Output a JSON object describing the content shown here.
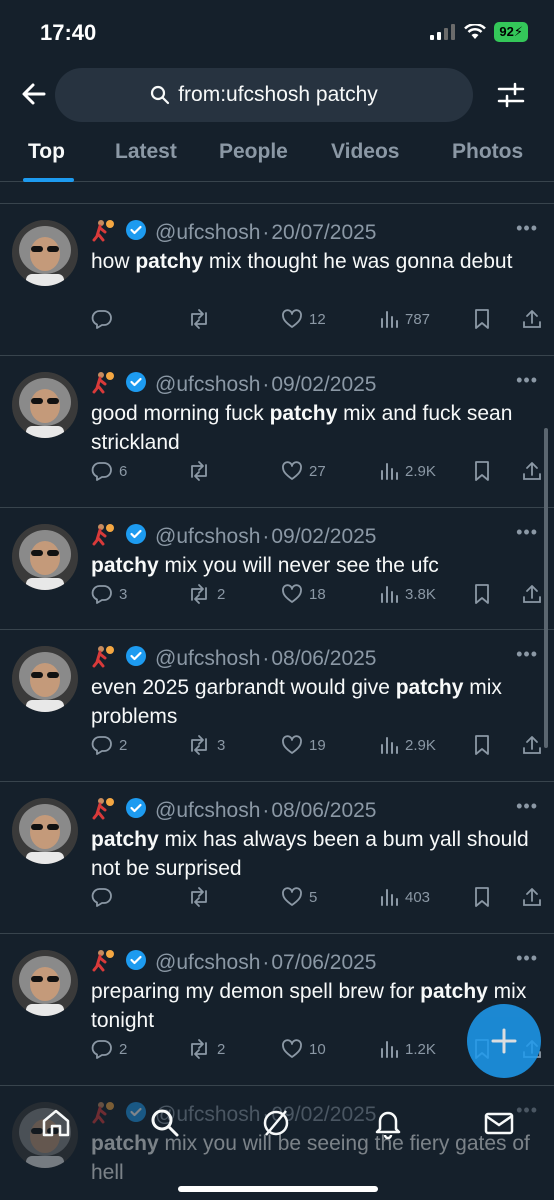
{
  "status_bar": {
    "time": "17:40",
    "battery": "92"
  },
  "search": {
    "query": "from:ufcshosh patchy"
  },
  "tabs": [
    {
      "label": "Top",
      "active": true
    },
    {
      "label": "Latest",
      "active": false
    },
    {
      "label": "People",
      "active": false
    },
    {
      "label": "Videos",
      "active": false
    },
    {
      "label": "Photos",
      "active": false
    }
  ],
  "colors": {
    "background": "#15202b",
    "accent": "#1d9bf0",
    "verified": "#1d9bf0",
    "muted_text": "#8b98a5",
    "divider": "#38444d"
  },
  "tweets": [
    {
      "handle": "@ufcshosh",
      "date": "20/07/2025",
      "segments": [
        {
          "t": "how "
        },
        {
          "t": "patchy",
          "b": true
        },
        {
          "t": " mix thought he was gonna debut"
        }
      ],
      "replies": "",
      "retweets": "",
      "likes": "12",
      "views": "787"
    },
    {
      "handle": "@ufcshosh",
      "date": "09/02/2025",
      "segments": [
        {
          "t": "good morning fuck "
        },
        {
          "t": "patchy",
          "b": true
        },
        {
          "t": " mix and fuck sean strickland"
        }
      ],
      "replies": "6",
      "retweets": "",
      "likes": "27",
      "views": "2.9K"
    },
    {
      "handle": "@ufcshosh",
      "date": "09/02/2025",
      "segments": [
        {
          "t": "patchy",
          "b": true
        },
        {
          "t": " mix you will never see the ufc"
        }
      ],
      "replies": "3",
      "retweets": "2",
      "likes": "18",
      "views": "3.8K"
    },
    {
      "handle": "@ufcshosh",
      "date": "08/06/2025",
      "segments": [
        {
          "t": "even 2025 garbrandt would give "
        },
        {
          "t": "patchy",
          "b": true
        },
        {
          "t": " mix problems"
        }
      ],
      "replies": "2",
      "retweets": "3",
      "likes": "19",
      "views": "2.9K"
    },
    {
      "handle": "@ufcshosh",
      "date": "08/06/2025",
      "segments": [
        {
          "t": "patchy",
          "b": true
        },
        {
          "t": " mix has always been a bum yall should not be surprised"
        }
      ],
      "replies": "",
      "retweets": "",
      "likes": "5",
      "views": "403"
    },
    {
      "handle": "@ufcshosh",
      "date": "07/06/2025",
      "segments": [
        {
          "t": "preparing my demon spell brew for "
        },
        {
          "t": "patchy",
          "b": true
        },
        {
          "t": " mix tonight"
        }
      ],
      "replies": "2",
      "retweets": "2",
      "likes": "10",
      "views": "1.2K"
    },
    {
      "handle": "@ufcshosh",
      "date": "09/02/2025",
      "segments": [
        {
          "t": "patchy",
          "b": true
        },
        {
          "t": " mix you will be seeing the fiery gates of hell"
        }
      ],
      "replies": "",
      "retweets": "",
      "likes": "",
      "views": ""
    }
  ],
  "tweet_heights": [
    152,
    152,
    122,
    152,
    152,
    152,
    140
  ],
  "tweet_body_lines": [
    2,
    2,
    1,
    2,
    2,
    2,
    2
  ],
  "icons": {
    "back": "arrow-left-icon",
    "search": "search-icon",
    "filter": "sliders-icon",
    "emoji": "basketball-player-emoji-icon",
    "verified": "verified-badge-icon",
    "more": "more-dots-icon",
    "reply": "reply-icon",
    "retweet": "retweet-icon",
    "like": "heart-icon",
    "views": "views-icon",
    "bookmark": "bookmark-icon",
    "share": "share-icon",
    "compose": "plus-icon",
    "nav": [
      "home-icon",
      "search-icon",
      "grok-icon",
      "bell-icon",
      "mail-icon"
    ]
  }
}
